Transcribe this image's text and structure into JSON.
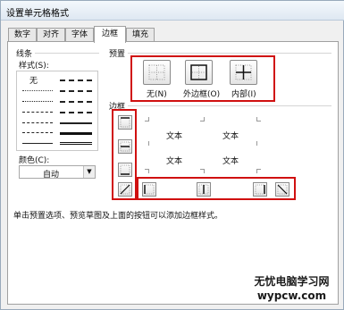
{
  "window": {
    "title": "设置单元格格式"
  },
  "tabs": [
    {
      "label": "数字"
    },
    {
      "label": "对齐"
    },
    {
      "label": "字体"
    },
    {
      "label": "边框"
    },
    {
      "label": "填充"
    }
  ],
  "line_group": {
    "title": "线条",
    "style_label": "样式(S):",
    "none_label": "无",
    "color_label": "颜色(C):",
    "color_value": "自动"
  },
  "presets": {
    "title": "预置",
    "none": "无(N)",
    "outline": "外边框(O)",
    "inside": "内部(I)"
  },
  "border": {
    "title": "边框",
    "preview_text": "文本"
  },
  "footer_text": "单击预置选项、预览草图及上面的按钮可以添加边框样式。",
  "watermark": {
    "line1": "无忧电脑学习网",
    "line2": "wypcw.com"
  },
  "colors": {
    "highlight": "#d01010",
    "active_tab": "#ffffff"
  }
}
